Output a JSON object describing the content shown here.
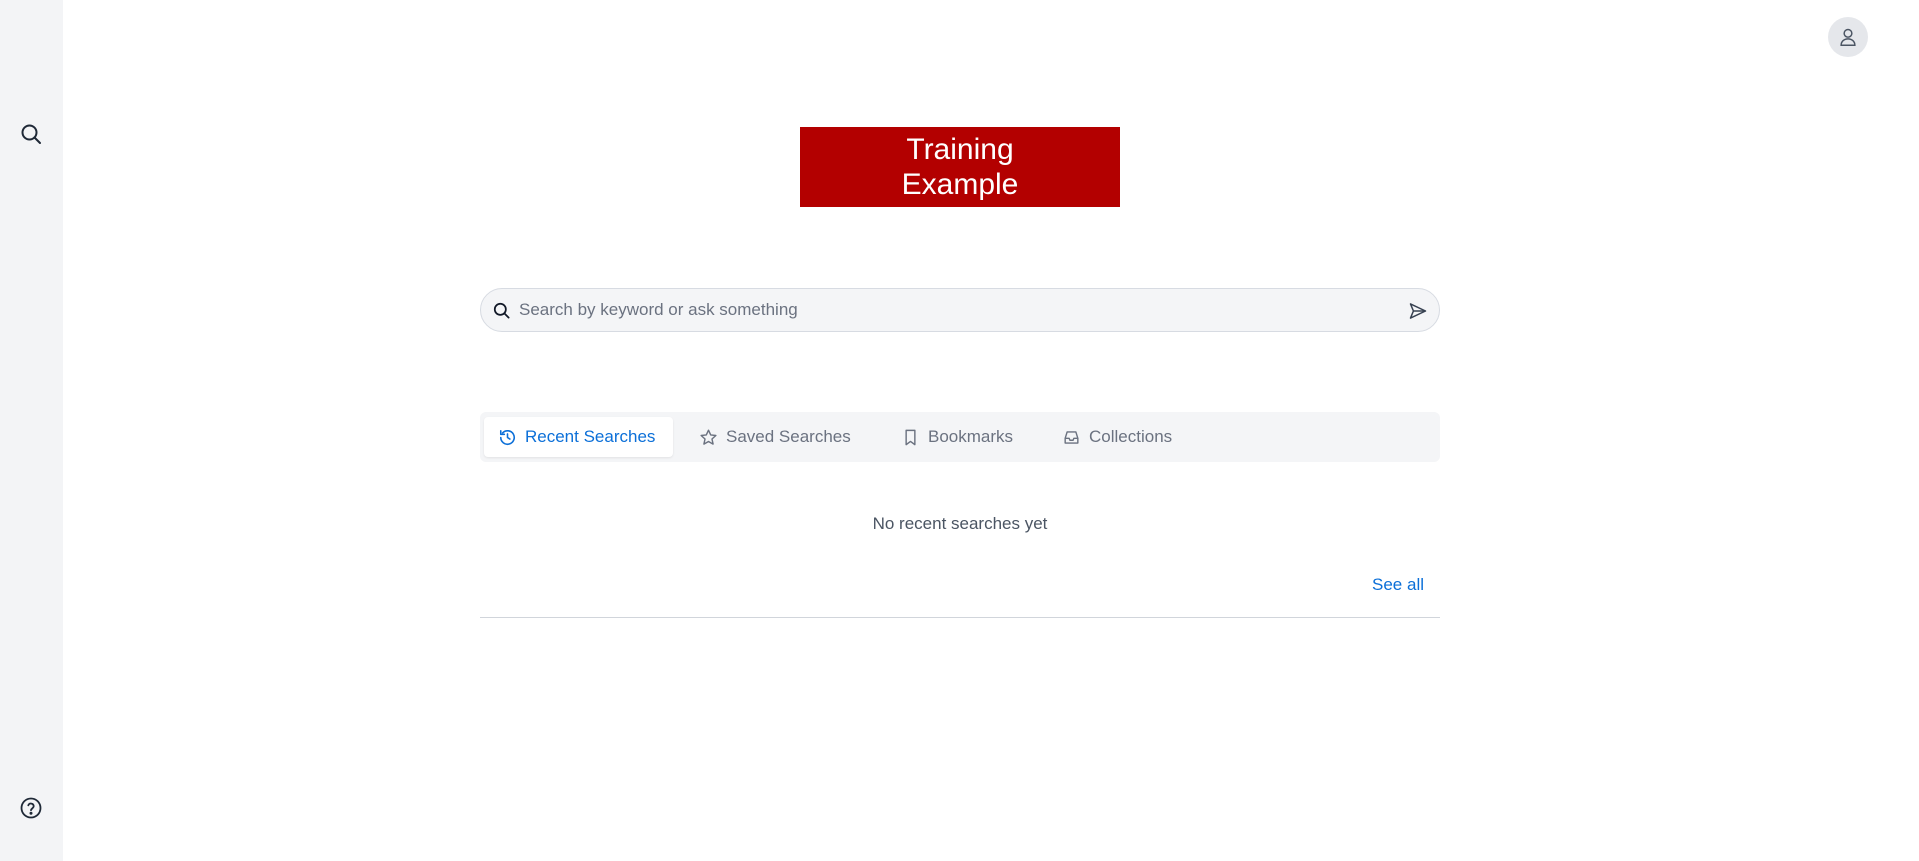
{
  "banner": {
    "line1": "Training",
    "line2": "Example"
  },
  "search": {
    "placeholder": "Search by keyword or ask something",
    "value": ""
  },
  "tabs": [
    {
      "label": "Recent Searches",
      "icon": "history-icon",
      "active": true
    },
    {
      "label": "Saved Searches",
      "icon": "star-icon",
      "active": false
    },
    {
      "label": "Bookmarks",
      "icon": "bookmark-icon",
      "active": false
    },
    {
      "label": "Collections",
      "icon": "inbox-icon",
      "active": false
    }
  ],
  "recent": {
    "empty_message": "No recent searches yet",
    "see_all_label": "See all"
  },
  "colors": {
    "accent": "#0b6fd8",
    "banner": "#b30000",
    "rail": "#f3f4f6"
  },
  "icons": {
    "rail_top": "search-icon",
    "rail_bottom": "help-icon",
    "top_right": "user-icon",
    "search_field": "search-icon",
    "search_submit": "send-icon"
  }
}
